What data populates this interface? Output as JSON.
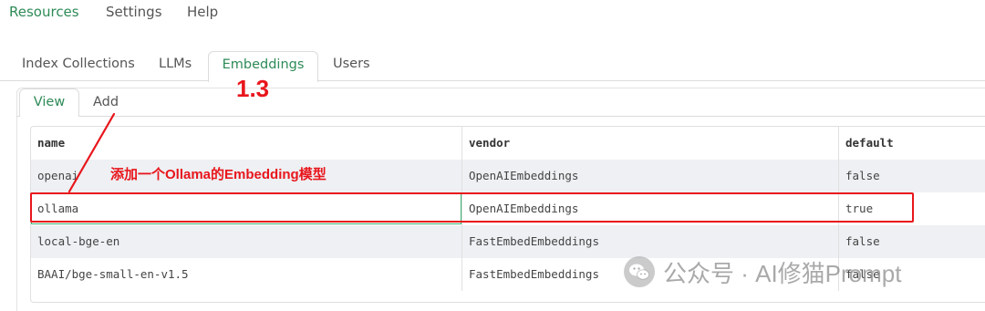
{
  "topnav": {
    "resources": "Resources",
    "settings": "Settings",
    "help": "Help"
  },
  "tabs": {
    "index_collections": "Index Collections",
    "llms": "LLMs",
    "embeddings": "Embeddings",
    "users": "Users"
  },
  "subtabs": {
    "view": "View",
    "add": "Add"
  },
  "table": {
    "headers": [
      "name",
      "vendor",
      "default"
    ],
    "rows": [
      [
        "openai",
        "OpenAIEmbeddings",
        "false"
      ],
      [
        "ollama",
        "OpenAIEmbeddings",
        "true"
      ],
      [
        "local-bge-en",
        "FastEmbedEmbeddings",
        "false"
      ],
      [
        "BAAI/bge-small-en-v1.5",
        "FastEmbedEmbeddings",
        "false"
      ]
    ]
  },
  "annotations": {
    "step_label": "1.3",
    "note": "添加一个Ollama的Embedding模型",
    "color": "#e8161c"
  },
  "watermark": {
    "text": "公众号 · AI修猫Prompt",
    "icon": "wechat-icon"
  },
  "colors": {
    "accent": "#2e8b57",
    "row_alt": "#eef0f3"
  }
}
